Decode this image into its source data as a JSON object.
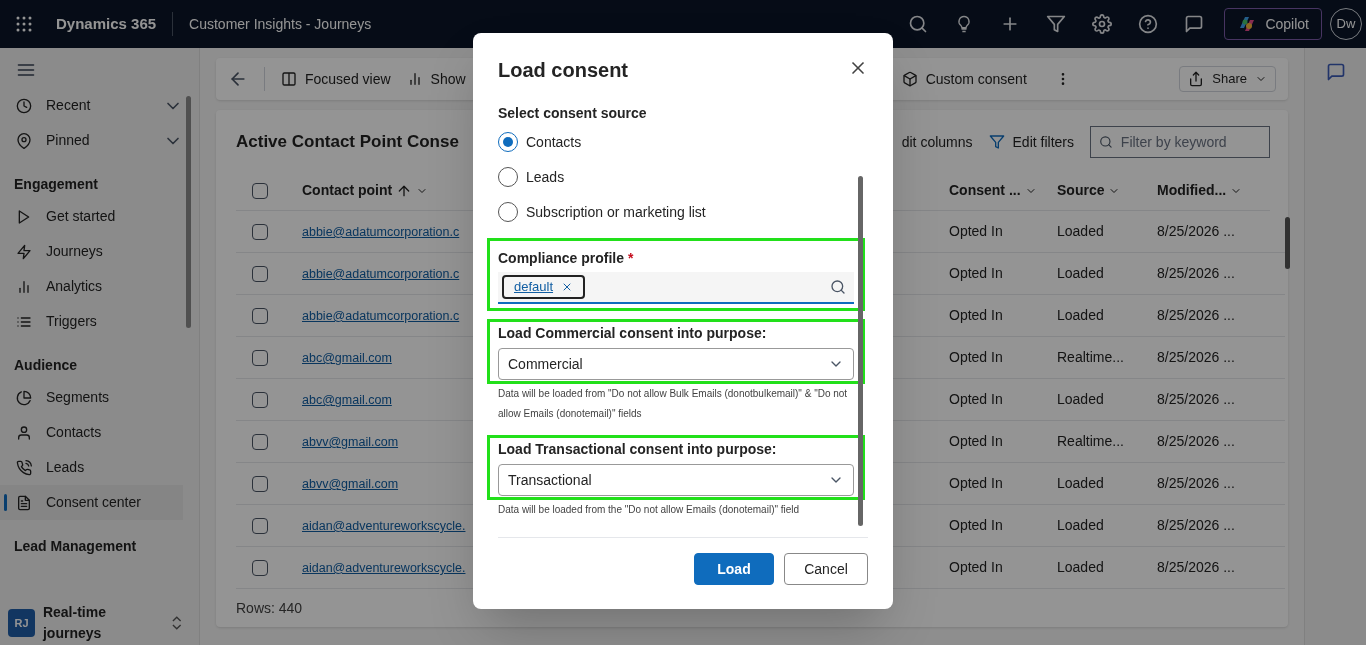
{
  "top_bar": {
    "app_name": "Dynamics 365",
    "app_title": "Customer Insights - Journeys",
    "copilot_label": "Copilot",
    "avatar_initials": "Dw"
  },
  "sidebar": {
    "items": [
      {
        "kind": "group",
        "label": "Recent",
        "selected": false
      },
      {
        "kind": "group",
        "label": "Pinned",
        "selected": false
      },
      {
        "kind": "heading",
        "label": "Engagement"
      },
      {
        "kind": "item",
        "label": "Get started",
        "selected": false
      },
      {
        "kind": "item",
        "label": "Journeys",
        "selected": false
      },
      {
        "kind": "item",
        "label": "Analytics",
        "selected": false
      },
      {
        "kind": "item",
        "label": "Triggers",
        "selected": false
      },
      {
        "kind": "heading",
        "label": "Audience"
      },
      {
        "kind": "item",
        "label": "Segments",
        "selected": false
      },
      {
        "kind": "item",
        "label": "Contacts",
        "selected": false
      },
      {
        "kind": "item",
        "label": "Leads",
        "selected": false
      },
      {
        "kind": "item",
        "label": "Consent center",
        "selected": true
      },
      {
        "kind": "heading",
        "label": "Lead Management"
      }
    ],
    "area": {
      "badge": "RJ",
      "label": "Real-time journeys"
    }
  },
  "command_bar": {
    "items": [
      {
        "label": "Focused view"
      },
      {
        "label": "Show"
      },
      {
        "label": "Custom consent"
      }
    ],
    "share_label": "Share"
  },
  "grid": {
    "title": "Active Contact Point Conse",
    "toolbar": [
      "dit columns",
      "Edit filters"
    ],
    "filter_placeholder": "Filter by keyword",
    "all_checked": false,
    "columns": [
      {
        "label": "Contact point",
        "sorted": true
      },
      {
        "label": "Consent ...",
        "sorted": false
      },
      {
        "label": "Source",
        "sorted": false
      },
      {
        "label": "Modified...",
        "sorted": false
      }
    ],
    "rows": [
      {
        "checked": false,
        "contact_point": "abbie@adatumcorporation.c",
        "consent": "Opted In",
        "source": "Loaded",
        "modified": "8/25/2026 ..."
      },
      {
        "checked": false,
        "contact_point": "abbie@adatumcorporation.c",
        "consent": "Opted In",
        "source": "Loaded",
        "modified": "8/25/2026 ..."
      },
      {
        "checked": false,
        "contact_point": "abbie@adatumcorporation.c",
        "consent": "Opted In",
        "source": "Loaded",
        "modified": "8/25/2026 ..."
      },
      {
        "checked": false,
        "contact_point": "abc@gmail.com",
        "consent": "Opted In",
        "source": "Realtime...",
        "modified": "8/25/2026 ..."
      },
      {
        "checked": false,
        "contact_point": "abc@gmail.com",
        "consent": "Opted In",
        "source": "Loaded",
        "modified": "8/25/2026 ..."
      },
      {
        "checked": false,
        "contact_point": "abvv@gmail.com",
        "consent": "Opted In",
        "source": "Realtime...",
        "modified": "8/25/2026 ..."
      },
      {
        "checked": false,
        "contact_point": "abvv@gmail.com",
        "consent": "Opted In",
        "source": "Loaded",
        "modified": "8/25/2026 ..."
      },
      {
        "checked": false,
        "contact_point": "aidan@adventureworkscycle.",
        "consent": "Opted In",
        "source": "Loaded",
        "modified": "8/25/2026 ..."
      },
      {
        "checked": false,
        "contact_point": "aidan@adventureworkscycle.",
        "consent": "Opted In",
        "source": "Loaded",
        "modified": "8/25/2026 ..."
      }
    ],
    "row_count": "Rows: 440"
  },
  "dialog": {
    "title": "Load consent",
    "source_label": "Select consent source",
    "options": [
      {
        "label": "Contacts",
        "selected": true
      },
      {
        "label": "Leads",
        "selected": false
      },
      {
        "label": "Subscription or marketing list",
        "selected": false
      }
    ],
    "compliance": {
      "label": "Compliance profile",
      "required_mark": "*",
      "tag": "default",
      "highlighted": true
    },
    "purposes": [
      {
        "label": "Load Commercial consent into purpose:",
        "value": "Commercial",
        "note": "Data will be loaded from \"Do not allow Bulk Emails (donotbulkemail)\" & \"Do not allow Emails (donotemail)\" fields",
        "highlighted": true
      },
      {
        "label": "Load Transactional consent into purpose:",
        "value": "Transactional",
        "note": "Data will be loaded from the \"Do not allow Emails (donotemail)\" field",
        "highlighted": true
      }
    ],
    "buttons": [
      {
        "label": "Load",
        "kind": "primary"
      },
      {
        "label": "Cancel",
        "kind": "secondary"
      }
    ]
  }
}
